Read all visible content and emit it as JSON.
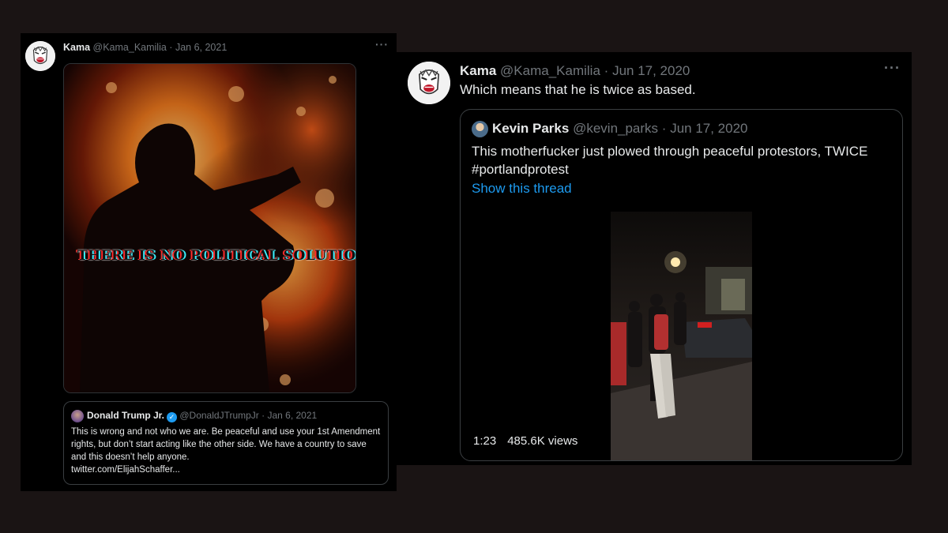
{
  "left_tweet": {
    "name": "Kama",
    "handle": "@Kama_Kamilia",
    "date": "Jan 6, 2021",
    "more": "···",
    "image_text": "THERE IS NO POLITICAL SOLUTION",
    "quoted": {
      "name": "Donald Trump Jr.",
      "verified_mark": "✓",
      "handle": "@DonaldJTrumpJr",
      "date": "Jan 6, 2021",
      "text": "This is wrong and not who we are. Be peaceful and use your 1st Amendment rights, but don’t start acting like the other side. We have a country to save and this doesn’t help anyone.",
      "link": "twitter.com/ElijahSchaffer..."
    }
  },
  "right_tweet": {
    "name": "Kama",
    "handle": "@Kama_Kamilia",
    "date": "Jun 17, 2020",
    "more": "···",
    "text": "Which means that he is twice as based.",
    "quoted": {
      "name": "Kevin Parks",
      "handle": "@kevin_parks",
      "date": "Jun 17, 2020",
      "line1": "This motherfucker just plowed through peaceful protestors, TWICE",
      "line2": "#portlandprotest",
      "show_thread": "Show this thread",
      "video_duration": "1:23",
      "video_views": "485.6K views"
    }
  },
  "colors": {
    "background": "#1a1414",
    "card": "#000000",
    "link": "#1d9bf0",
    "muted": "#71767b",
    "border": "#3a3e41"
  }
}
